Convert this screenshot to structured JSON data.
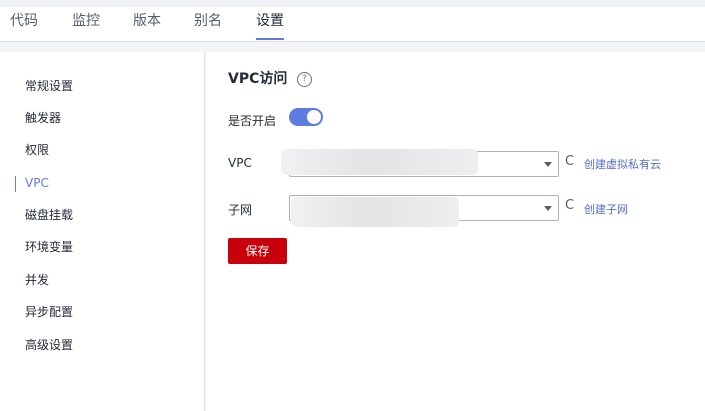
{
  "tabs": [
    "代码",
    "监控",
    "版本",
    "别名",
    "设置"
  ],
  "active_tab": "设置",
  "sidebar": [
    "常规设置",
    "触发器",
    "权限",
    "VPC",
    "磁盘挂载",
    "环境变量",
    "并发",
    "异步配置",
    "高级设置"
  ],
  "active_sidebar": "VPC",
  "section": {
    "title": "VPC访问",
    "help_icon": "?",
    "enable_label": "是否开启",
    "enabled": true
  },
  "vpc": {
    "label": "VPC",
    "refresh_icon": "C",
    "link": "创建虚拟私有云"
  },
  "subnet": {
    "label": "子网",
    "refresh_icon": "C",
    "link": "创建子网"
  },
  "save_label": "保存",
  "colors": {
    "accent": "#5e7ce0",
    "primary_button": "#c7000b",
    "link": "#526ecc"
  }
}
